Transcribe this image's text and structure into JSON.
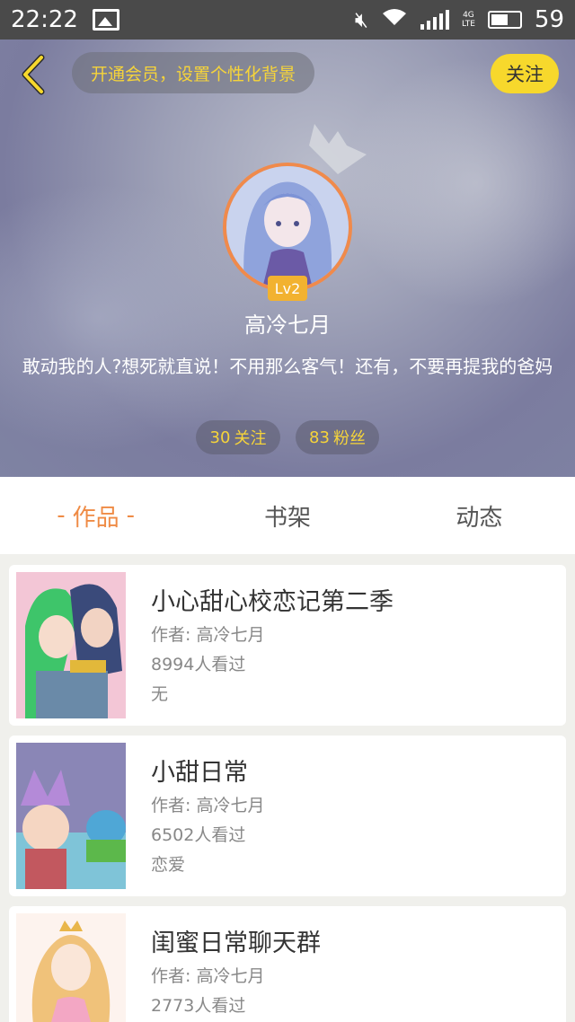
{
  "status_bar": {
    "time": "22:22",
    "network": "4G",
    "network_sub": "LTE",
    "battery": "59"
  },
  "header": {
    "vip_banner": "开通会员，设置个性化背景",
    "follow_label": "关注",
    "level": "Lv2",
    "username": "高冷七月",
    "bio": "敢动我的人?想死就直说！不用那么客气！还有，不要再提我的爸妈",
    "following_count": "30",
    "following_label": "关注",
    "fans_count": "83",
    "fans_label": "粉丝",
    "accent_color": "#f7d82c"
  },
  "tabs": [
    {
      "label": "作品",
      "active": true
    },
    {
      "label": "书架",
      "active": false
    },
    {
      "label": "动态",
      "active": false
    }
  ],
  "works": [
    {
      "title": "小心甜心校恋记第二季",
      "author": "作者: 高冷七月",
      "views": "8994人看过",
      "tag": "无"
    },
    {
      "title": "小甜日常",
      "author": "作者: 高冷七月",
      "views": "6502人看过",
      "tag": "恋爱"
    },
    {
      "title": "闺蜜日常聊天群",
      "author": "作者: 高冷七月",
      "views": "2773人看过",
      "tag": ""
    }
  ]
}
